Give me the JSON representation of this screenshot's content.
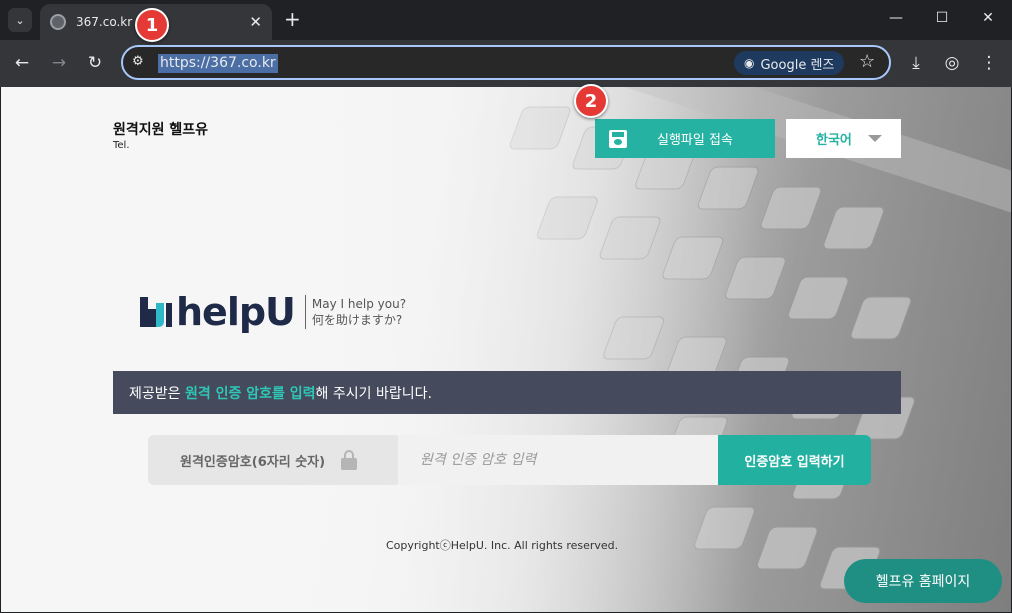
{
  "browser": {
    "tab_title": "367.co.kr",
    "tab_close": "✕",
    "new_tab": "+",
    "url": "https://367.co.kr",
    "lens_label": "Google 렌즈",
    "icons": [
      "tab-search-icon",
      "back-icon",
      "forward-icon",
      "reload-icon",
      "site-settings-icon",
      "lens-icon",
      "bookmark-star-icon",
      "download-icon",
      "profile-icon",
      "menu-icon",
      "minimize-icon",
      "maximize-icon",
      "close-window-icon"
    ]
  },
  "header": {
    "brand_name": "원격지원 헬프유",
    "tel": "Tel.",
    "exe_button": "실행파일 접속",
    "language": "한국어"
  },
  "logo": {
    "wordmark": "helpU",
    "tagline_en": "May I help you?",
    "tagline_jp": "何を助けますか?"
  },
  "banner": {
    "prefix": "제공받은 ",
    "highlight": "원격 인증 암호를 입력",
    "suffix": "해 주시기 바랍니다."
  },
  "password": {
    "label": "원격인증암호(6자리 숫자)",
    "placeholder": "원격 인증 암호 입력",
    "submit": "인증암호 입력하기"
  },
  "footer": {
    "copyright": "CopyrightⓒHelpU. Inc. All rights reserved.",
    "home_button": "헬프유 홈페이지"
  },
  "annotations": {
    "badge1": "1",
    "badge2": "2"
  },
  "colors": {
    "accent": "#26b2a3",
    "banner_bg": "#454a5c",
    "highlight": "#2ec7b6",
    "badge": "#e53935"
  }
}
